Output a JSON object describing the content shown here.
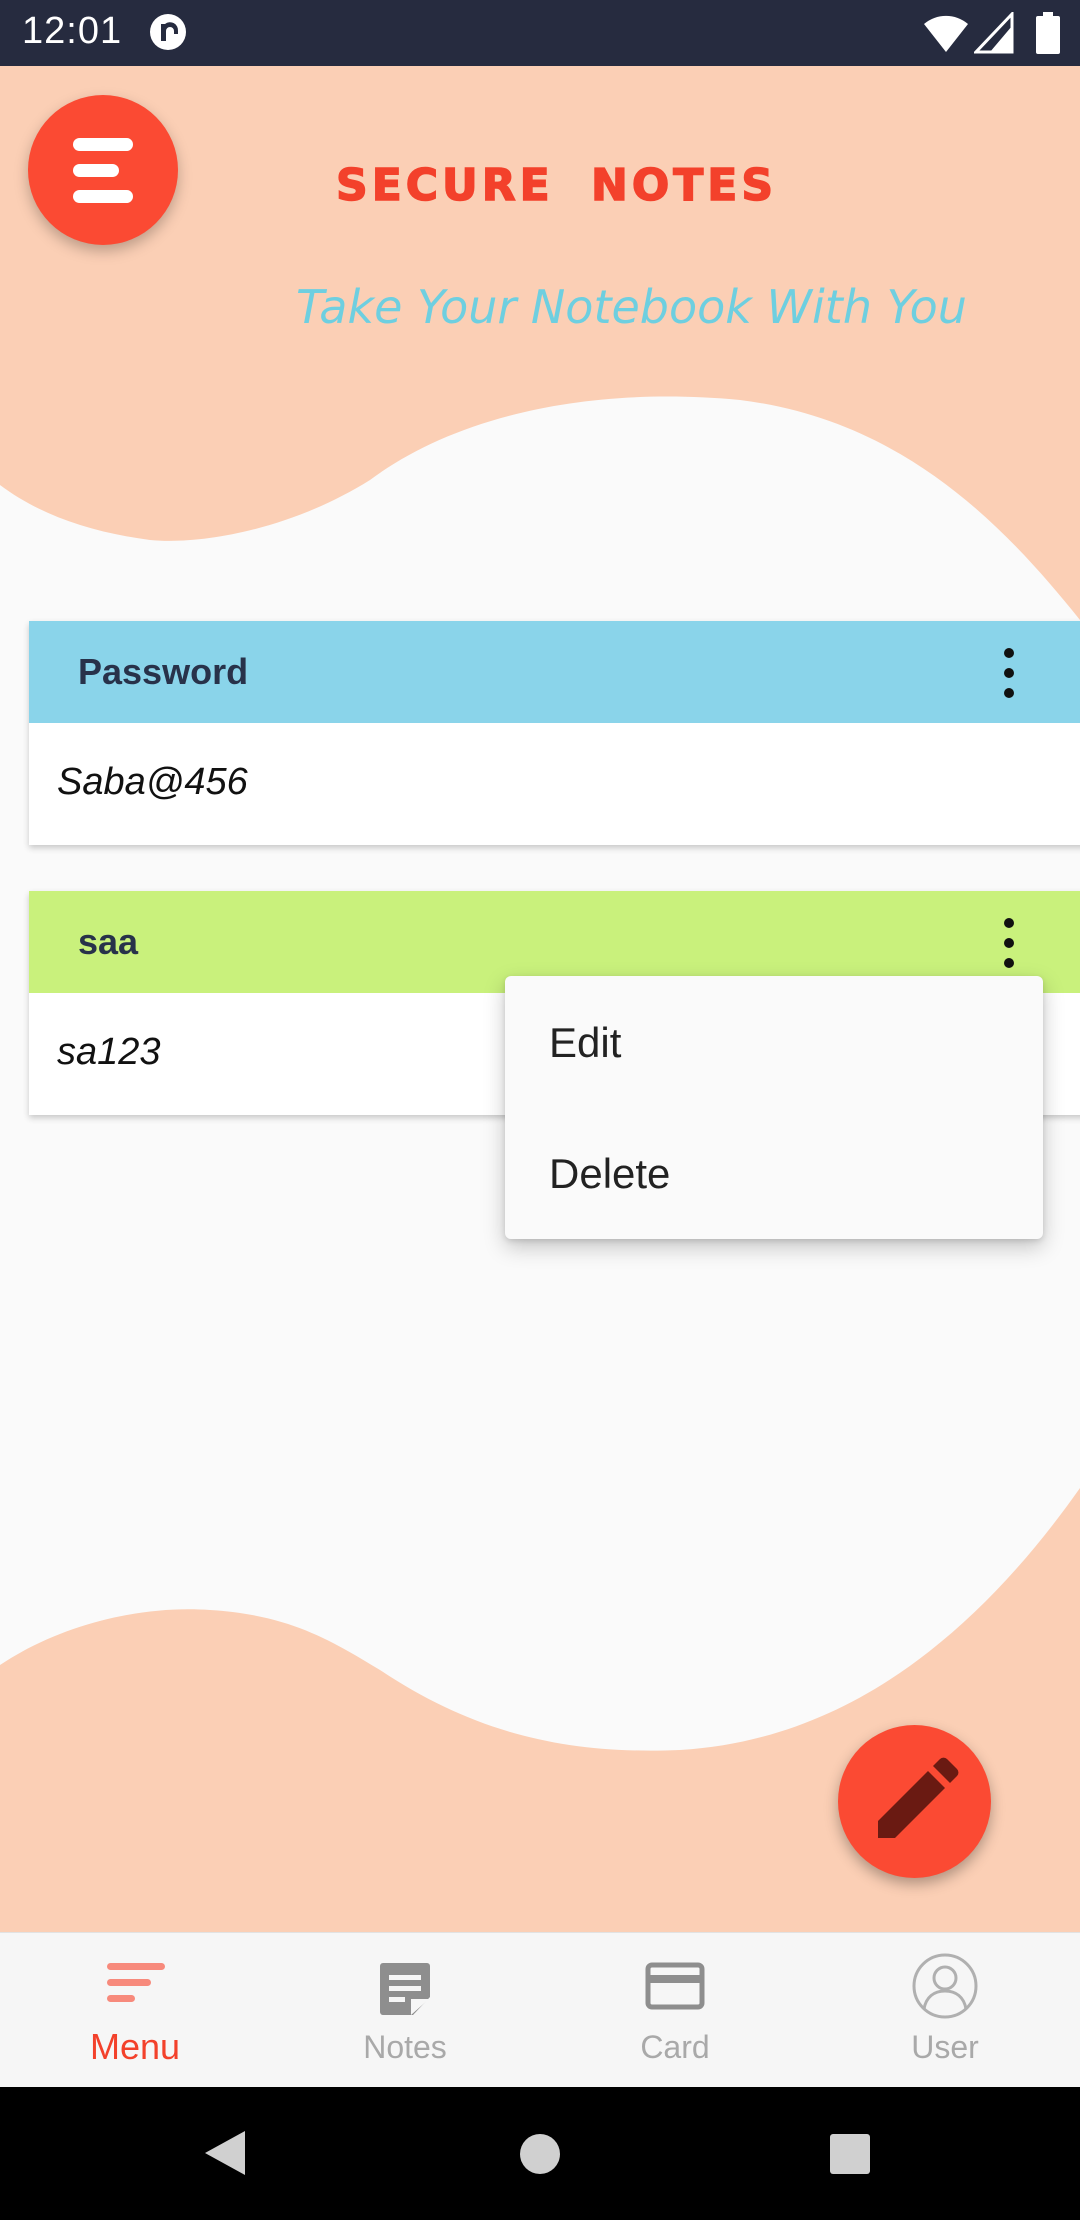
{
  "status_bar": {
    "time": "12:01",
    "icons": [
      "app-notification-icon",
      "wifi-icon",
      "cell-signal-icon",
      "battery-icon"
    ]
  },
  "header": {
    "menu_icon": "menu-lines-icon",
    "title": "SECURE NOTES",
    "subtitle": "Take Your Notebook With You"
  },
  "notes": [
    {
      "title": "Password",
      "value": "Saba@456",
      "header_color": "#8ad4ea",
      "more_icon": "more-vert-icon"
    },
    {
      "title": "saa",
      "value": "sa123",
      "header_color": "#c9f17c",
      "more_icon": "more-vert-icon"
    }
  ],
  "popup_menu": {
    "items": [
      "Edit",
      "Delete"
    ]
  },
  "fab": {
    "icon": "pencil-icon"
  },
  "bottom_nav": {
    "items": [
      {
        "label": "Menu",
        "icon": "menu-sort-icon",
        "active": true
      },
      {
        "label": "Notes",
        "icon": "note-icon",
        "active": false
      },
      {
        "label": "Card",
        "icon": "credit-card-icon",
        "active": false
      },
      {
        "label": "User",
        "icon": "user-icon",
        "active": false
      }
    ]
  },
  "system_nav": {
    "icons": [
      "back-icon",
      "home-icon",
      "recents-icon"
    ]
  },
  "colors": {
    "accent": "#fb4a33",
    "peach": "#fbcfb5",
    "status_bar": "#262b3f",
    "subtitle": "#6ecfe0",
    "inactive": "#a9a9a9"
  }
}
